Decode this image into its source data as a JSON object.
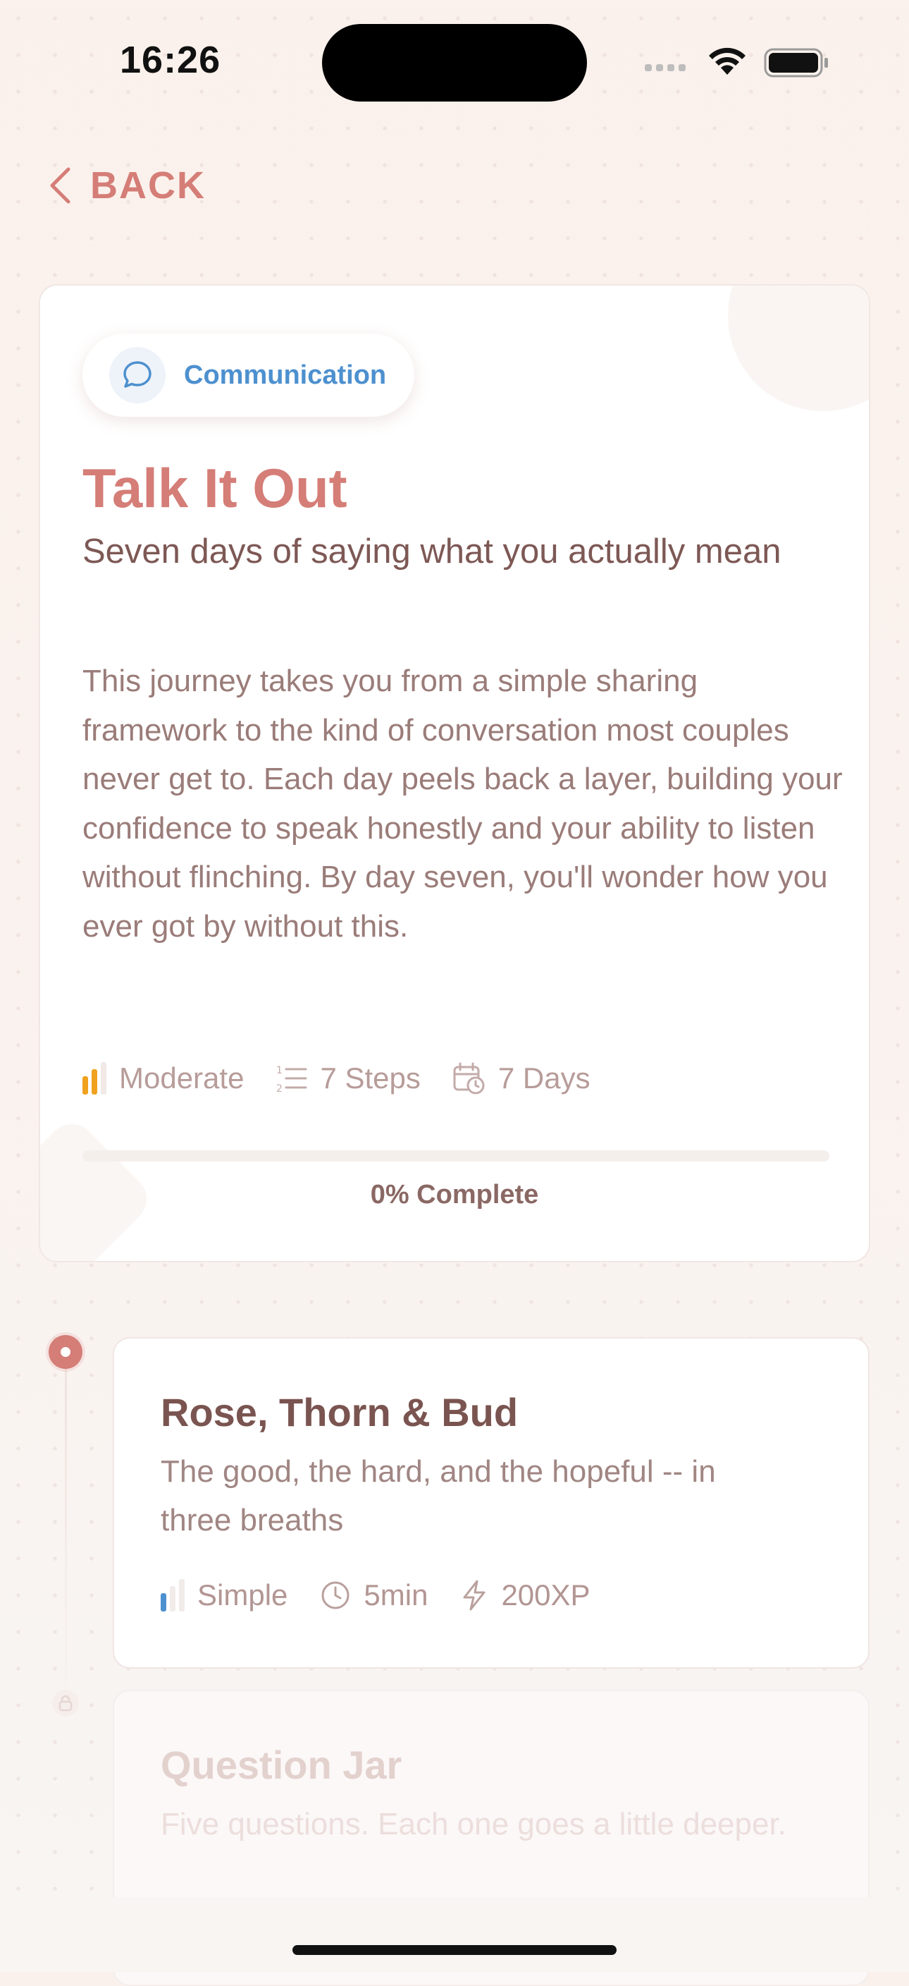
{
  "status_bar": {
    "time": "16:26"
  },
  "header": {
    "back_label": "BACK"
  },
  "journey": {
    "category": "Communication",
    "title": "Talk It Out",
    "subtitle": "Seven days of saying what you actually mean",
    "description": "This journey takes you from a simple sharing framework to the kind of conversation most couples never get to. Each day peels back a layer, building your confidence to speak honestly and your ability to listen without flinching. By day seven, you'll wonder how you ever got by without this.",
    "difficulty": "Moderate",
    "steps": "7 Steps",
    "duration": "7 Days",
    "progress_percent": 0,
    "progress_label": "0% Complete"
  },
  "steps_list": [
    {
      "title": "Rose, Thorn & Bud",
      "subtitle": "The good, the hard, and the hopeful -- in three breaths",
      "difficulty": "Simple",
      "time": "5min",
      "xp": "200XP",
      "locked": false
    },
    {
      "title": "Question Jar",
      "subtitle": "Five questions. Each one goes a little deeper.",
      "locked": true
    }
  ],
  "colors": {
    "accent": "#d57d77",
    "communication_blue": "#4d90cf",
    "moderate_orange": "#f0a21f",
    "simple_blue": "#4d90cf"
  },
  "icons": [
    "chevron-left-icon",
    "chat-bubble-icon",
    "difficulty-bars-icon",
    "list-numbered-icon",
    "calendar-clock-icon",
    "clock-icon",
    "lightning-icon",
    "lock-icon"
  ]
}
